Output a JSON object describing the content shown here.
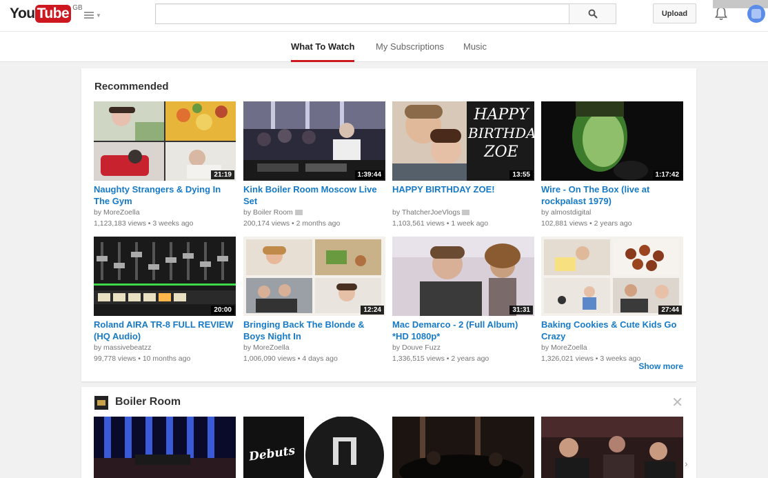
{
  "masthead": {
    "logo_you": "You",
    "logo_tube": "Tube",
    "logo_region": "GB",
    "search_placeholder": "",
    "upload_label": "Upload"
  },
  "tabs": [
    {
      "label": "What To Watch",
      "active": true
    },
    {
      "label": "My Subscriptions",
      "active": false
    },
    {
      "label": "Music",
      "active": false
    }
  ],
  "recommended": {
    "title": "Recommended",
    "show_more": "Show more",
    "videos": [
      {
        "title": "Naughty Strangers & Dying In The Gym",
        "channel": "by MoreZoella",
        "verified": false,
        "views": "1,123,183 views",
        "age": "3 weeks ago",
        "duration": "21:19"
      },
      {
        "title": "Kink Boiler Room Moscow Live Set",
        "channel": "by Boiler Room",
        "verified": true,
        "views": "200,174 views",
        "age": "2 months ago",
        "duration": "1:39:44"
      },
      {
        "title": "HAPPY BIRTHDAY ZOE!",
        "channel": "by ThatcherJoeVlogs",
        "verified": true,
        "views": "1,103,561 views",
        "age": "1 week ago",
        "duration": "13:55"
      },
      {
        "title": "Wire - On The Box (live at rockpalast 1979)",
        "channel": "by almostdigital",
        "verified": false,
        "views": "102,881 views",
        "age": "2 years ago",
        "duration": "1:17:42"
      },
      {
        "title": "Roland AIRA TR-8 FULL REVIEW (HQ Audio)",
        "channel": "by massivebeatzz",
        "verified": false,
        "views": "99,778 views",
        "age": "10 months ago",
        "duration": "20:00"
      },
      {
        "title": "Bringing Back The Blonde & Boys Night In",
        "channel": "by MoreZoella",
        "verified": false,
        "views": "1,006,090 views",
        "age": "4 days ago",
        "duration": "12:24"
      },
      {
        "title": "Mac Demarco - 2 (Full Album) *HD 1080p*",
        "channel": "by Douve Fuzz",
        "verified": false,
        "views": "1,336,515 views",
        "age": "2 years ago",
        "duration": "31:31"
      },
      {
        "title": "Baking Cookies & Cute Kids Go Crazy",
        "channel": "by MoreZoella",
        "verified": false,
        "views": "1,326,021 views",
        "age": "3 weeks ago",
        "duration": "27:44"
      }
    ]
  },
  "shelf": {
    "title": "Boiler Room",
    "close_glyph": "✕",
    "next_glyph": "›"
  },
  "thumb_text": {
    "birthday": [
      "HAPPY",
      "BIRTHDAY",
      "ZOE"
    ],
    "debuts": "Debuts"
  },
  "icons": {
    "search": "search-icon",
    "bell": "bell-icon",
    "guide": "menu-icon"
  },
  "colors": {
    "brand_red": "#cc181e",
    "link_blue": "#167ac6"
  }
}
